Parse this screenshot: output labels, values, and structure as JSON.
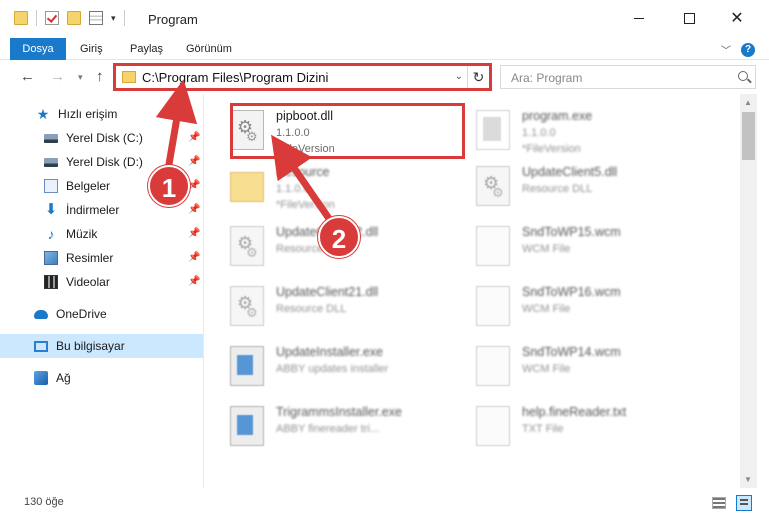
{
  "window": {
    "title": "Program"
  },
  "ribbon": {
    "tabs": [
      "Dosya",
      "Giriş",
      "Paylaş",
      "Görünüm"
    ]
  },
  "address": {
    "path": "C:\\Program Files\\Program Dizini"
  },
  "search": {
    "placeholder": "Ara: Program"
  },
  "sidebar": {
    "items": [
      {
        "label": "Hızlı erişim",
        "icon": "star-icon"
      },
      {
        "label": "Yerel Disk (C:)",
        "icon": "drive-icon"
      },
      {
        "label": "Yerel Disk (D:)",
        "icon": "drive-icon"
      },
      {
        "label": "Belgeler",
        "icon": "documents-icon"
      },
      {
        "label": "İndirmeler",
        "icon": "downloads-icon"
      },
      {
        "label": "Müzik",
        "icon": "music-icon"
      },
      {
        "label": "Resimler",
        "icon": "pictures-icon"
      },
      {
        "label": "Videolar",
        "icon": "videos-icon"
      },
      {
        "label": "OneDrive",
        "icon": "cloud-icon"
      },
      {
        "label": "Bu bilgisayar",
        "icon": "computer-icon"
      },
      {
        "label": "Ağ",
        "icon": "network-icon"
      }
    ]
  },
  "files": [
    {
      "name": "pipboot.dll",
      "line2": "1.1.0.0",
      "line3": "*FileVersion",
      "icon": "dll-gear-icon"
    },
    {
      "name": "program.exe",
      "line2": "1.1.0.0",
      "line3": "*FileVersion",
      "icon": "program-exe-icon"
    },
    {
      "name": "Resource",
      "line2": "1.1.0.0",
      "line3": "*FileVersion",
      "icon": "folder-icon"
    },
    {
      "name": "UpdateClient5.dll",
      "line2": "Resource DLL",
      "line3": "",
      "icon": "dll-gear-icon"
    },
    {
      "name": "UpdateClient42.dll",
      "line2": "Resource DLL",
      "line3": "",
      "icon": "dll-gear-icon"
    },
    {
      "name": "SndToWP15.wcm",
      "line2": "WCM File",
      "line3": "",
      "icon": "blank-document-icon"
    },
    {
      "name": "UpdateClient21.dll",
      "line2": "Resource DLL",
      "line3": "",
      "icon": "dll-gear-icon"
    },
    {
      "name": "SndToWP16.wcm",
      "line2": "WCM File",
      "line3": "",
      "icon": "blank-document-icon"
    },
    {
      "name": "UpdateInstaller.exe",
      "line2": "ABBY updates installer",
      "line3": "",
      "icon": "installer-exe-icon"
    },
    {
      "name": "SndToWP14.wcm",
      "line2": "WCM File",
      "line3": "",
      "icon": "blank-document-icon"
    },
    {
      "name": "TrigrammsInstaller.exe",
      "line2": "ABBY finereader tri...",
      "line3": "",
      "icon": "installer-exe-icon"
    },
    {
      "name": "help.fineReader.txt",
      "line2": "TXT File",
      "line3": "",
      "icon": "blank-document-icon"
    }
  ],
  "status": {
    "count_text": "130 öğe"
  },
  "callouts": {
    "one": "1",
    "two": "2"
  },
  "colors": {
    "accent": "#1979ca",
    "highlight": "#d93a3a",
    "selection": "#cce8ff"
  }
}
